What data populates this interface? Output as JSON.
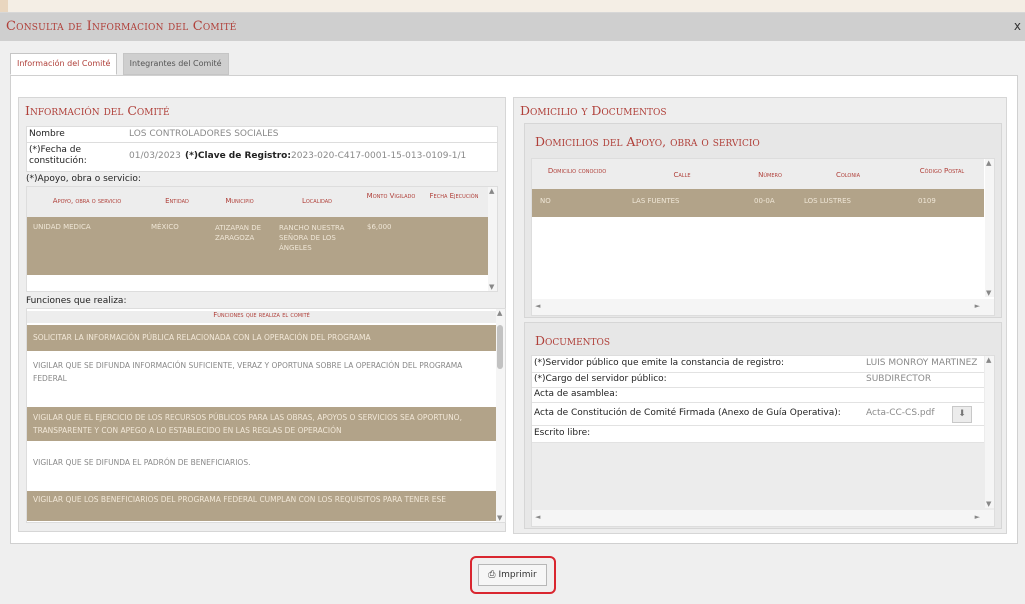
{
  "modal": {
    "title": "Consulta de Informacion del Comité",
    "close": "x"
  },
  "tabs": [
    {
      "label": "Información del Comité",
      "active": true
    },
    {
      "label": "Integrantes del Comité",
      "active": false
    }
  ],
  "info": {
    "title": "Información del Comité",
    "nombre_label": "Nombre",
    "nombre_value": "LOS CONTROLADORES SOCIALES",
    "fecha_label": "(*)Fecha de constitución:",
    "fecha_value": "01/03/2023",
    "clave_label": "(*)Clave de Registro:",
    "clave_value": "2023-020-C417-0001-15-013-0109-1/1",
    "apoyo_label": "(*)Apoyo, obra o servicio:",
    "apoyo_headers": [
      "Apoyo, obra o servicio",
      "Entidad",
      "Municipio",
      "Localidad",
      "Monto Vigilado",
      "Fecha Ejecución"
    ],
    "apoyo_row": [
      "UNIDAD MEDICA",
      "MÉXICO",
      "ATIZAPAN DE ZARAGOZA",
      "RANCHO NUESTRA SEÑORA DE LOS ÁNGELES",
      "$6,000",
      ""
    ],
    "funciones_label": "Funciones que realiza:",
    "funciones_header": "Funciones que realiza el comité",
    "funciones": [
      "SOLICITAR LA INFORMACIÓN PÚBLICA RELACIONADA CON LA OPERACIÓN DEL PROGRAMA",
      "VIGILAR QUE SE DIFUNDA INFORMACIÓN SUFICIENTE, VERAZ Y OPORTUNA SOBRE LA OPERACIÓN DEL PROGRAMA FEDERAL",
      "VIGILAR QUE EL EJERCICIO DE LOS RECURSOS PÚBLICOS PARA LAS OBRAS, APOYOS O SERVICIOS SEA OPORTUNO, TRANSPARENTE Y CON APEGO A LO ESTABLECIDO EN LAS REGLAS DE OPERACIÓN",
      "VIGILAR QUE SE DIFUNDA EL PADRÓN DE BENEFICIARIOS.",
      "VIGILAR QUE LOS BENEFICIARIOS DEL PROGRAMA FEDERAL CUMPLAN CON LOS REQUISITOS PARA TENER ESE"
    ]
  },
  "domicilio": {
    "title": "Domicilio y Documentos",
    "sub_title": "Domicilios del Apoyo, obra o servicio",
    "headers": [
      "Domicilio conocido",
      "Calle",
      "Número",
      "Colonia",
      "Código Postal"
    ],
    "row": [
      "NO",
      "LAS FUENTES",
      "00-0A",
      "LOS LUSTRES",
      "0109"
    ]
  },
  "documentos": {
    "title": "Documentos",
    "rows": [
      {
        "label": "(*)Servidor público que emite la constancia de registro:",
        "value": "LUIS MONROY MARTINEZ"
      },
      {
        "label": "(*)Cargo del servidor público:",
        "value": "SUBDIRECTOR"
      },
      {
        "label": "Acta de asamblea:",
        "value": ""
      },
      {
        "label": "Acta de Constitución de Comité Firmada (Anexo de Guía Operativa):",
        "value": "Acta-CC-CS.pdf"
      },
      {
        "label": "Escrito libre:",
        "value": ""
      }
    ]
  },
  "print_button": "Imprimir",
  "colors": {
    "accent": "#b0403a",
    "tan": "#b2a389",
    "highlight": "#d9262f"
  }
}
